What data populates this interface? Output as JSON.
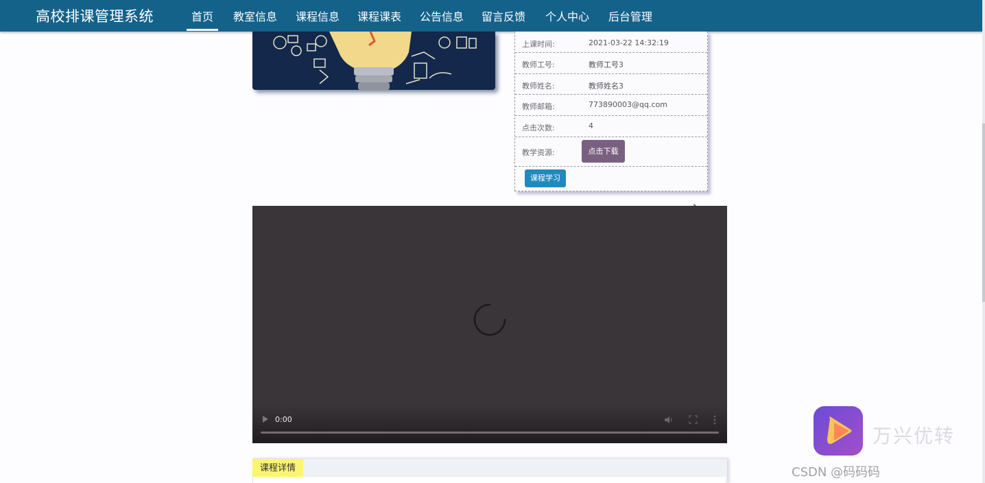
{
  "app": {
    "title": "高校排课管理系统"
  },
  "nav": {
    "items": [
      {
        "label": "首页",
        "active": true
      },
      {
        "label": "教室信息"
      },
      {
        "label": "课程信息"
      },
      {
        "label": "课程课表"
      },
      {
        "label": "公告信息"
      },
      {
        "label": "留言反馈"
      },
      {
        "label": "个人中心"
      },
      {
        "label": "后台管理"
      }
    ]
  },
  "course_info": {
    "rows": [
      {
        "label": "上课时间:",
        "value": "2021-03-22 14:32:19"
      },
      {
        "label": "教师工号:",
        "value": "教师工号3"
      },
      {
        "label": "教师姓名:",
        "value": "教师姓名3"
      },
      {
        "label": "教师邮箱:",
        "value": "773890003@qq.com"
      },
      {
        "label": "点击次数:",
        "value": "4"
      },
      {
        "label": "教学资源:",
        "value": ""
      }
    ],
    "download_label": "点击下载",
    "study_label": "课程学习"
  },
  "video": {
    "time": "0:00",
    "progress": 0
  },
  "detail": {
    "tab_label": "课程详情"
  },
  "watermark": {
    "brand_text": "万兴优转",
    "csdn_text": "CSDN @码码码"
  },
  "colors": {
    "navbar": "#14628a",
    "download_button": "#7a6080",
    "study_button": "#2089bd",
    "detail_tab": "#fbf56f",
    "video_bg": "#3a3539"
  },
  "icons": {
    "play": "play-icon",
    "volume": "volume-icon",
    "fullscreen": "fullscreen-icon",
    "more": "more-vertical-icon",
    "spinner": "loading-spinner-icon",
    "cursor": "mouse-cursor-icon"
  }
}
